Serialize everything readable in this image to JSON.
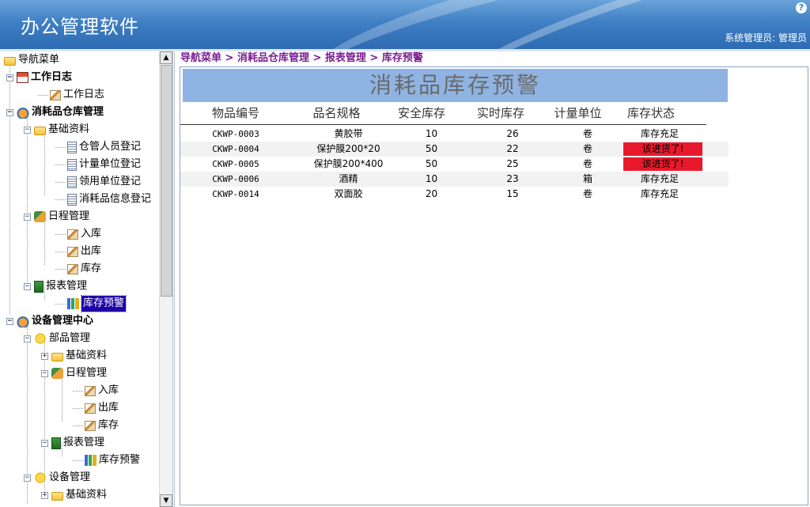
{
  "header": {
    "app_title": "办公管理软件",
    "help_label": "?",
    "user_text": "系统管理员: 管理员",
    "accent_color": "#3f7fc4"
  },
  "sidebar": {
    "nodes": [
      {
        "label": "导航菜单",
        "icon": "folder-open-icon"
      },
      {
        "label": "工作日志",
        "icon": "home-icon"
      },
      {
        "label": "工作日志",
        "icon": "edit-icon"
      },
      {
        "label": "消耗品仓库管理",
        "icon": "house-icon"
      },
      {
        "label": "基础资料",
        "icon": "folder-open-icon"
      },
      {
        "label": "仓管人员登记",
        "icon": "document-icon"
      },
      {
        "label": "计量单位登记",
        "icon": "document-icon"
      },
      {
        "label": "领用单位登记",
        "icon": "document-icon"
      },
      {
        "label": "消耗品信息登记",
        "icon": "document-icon"
      },
      {
        "label": "日程管理",
        "icon": "calendar-icon"
      },
      {
        "label": "入库",
        "icon": "edit-icon"
      },
      {
        "label": "出库",
        "icon": "edit-icon"
      },
      {
        "label": "库存",
        "icon": "edit-icon"
      },
      {
        "label": "报表管理",
        "icon": "report-icon"
      },
      {
        "label": "库存预警",
        "icon": "bar-chart-icon"
      },
      {
        "label": "设备管理中心",
        "icon": "house-icon"
      },
      {
        "label": "部品管理",
        "icon": "star-icon"
      },
      {
        "label": "基础资料",
        "icon": "folder-open-icon"
      },
      {
        "label": "日程管理",
        "icon": "calendar-icon"
      },
      {
        "label": "入库",
        "icon": "edit-icon"
      },
      {
        "label": "出库",
        "icon": "edit-icon"
      },
      {
        "label": "库存",
        "icon": "edit-icon"
      },
      {
        "label": "报表管理",
        "icon": "report-icon"
      },
      {
        "label": "库存预警",
        "icon": "bar-chart-icon"
      },
      {
        "label": "设备管理",
        "icon": "star-icon"
      },
      {
        "label": "基础资料",
        "icon": "folder-open-icon"
      }
    ]
  },
  "breadcrumb": "导航菜单 > 消耗品仓库管理 > 报表管理 > 库存预警",
  "report": {
    "title": "消耗品库存预警",
    "columns": [
      "物品编号",
      "品名规格",
      "安全库存",
      "实时库存",
      "计量单位",
      "库存状态"
    ],
    "rows": [
      {
        "code": "CKWP-0003",
        "name": "黄胶带",
        "safe": "10",
        "current": "26",
        "unit": "卷",
        "status": "库存充足",
        "alert": false
      },
      {
        "code": "CKWP-0004",
        "name": "保护膜200*20",
        "safe": "50",
        "current": "22",
        "unit": "卷",
        "status": "该进货了!",
        "alert": true
      },
      {
        "code": "CKWP-0005",
        "name": "保护膜200*400",
        "safe": "50",
        "current": "25",
        "unit": "卷",
        "status": "该进货了!",
        "alert": true
      },
      {
        "code": "CKWP-0006",
        "name": "酒精",
        "safe": "10",
        "current": "23",
        "unit": "箱",
        "status": "库存充足",
        "alert": false
      },
      {
        "code": "CKWP-0014",
        "name": "双面胶",
        "safe": "20",
        "current": "15",
        "unit": "卷",
        "status": "库存充足",
        "alert": false
      }
    ],
    "alert_color": "#e8192c"
  }
}
